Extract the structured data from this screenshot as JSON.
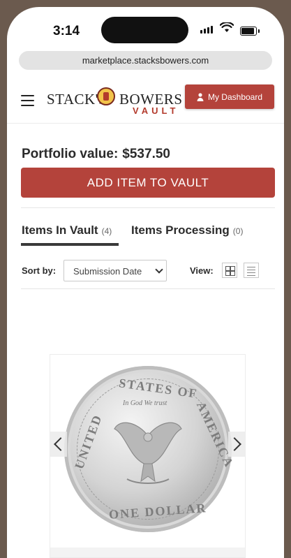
{
  "status_bar": {
    "time": "3:14"
  },
  "browser": {
    "url": "marketplace.stacksbowers.com"
  },
  "header": {
    "logo_word_1": "STACK'S",
    "logo_word_2": "BOWERS",
    "logo_word_3": "VAULT",
    "dashboard_label": "My Dashboard"
  },
  "portfolio": {
    "label": "Portfolio value:",
    "value": "$537.50"
  },
  "add_item_label": "ADD ITEM TO VAULT",
  "tabs": [
    {
      "label": "Items In Vault",
      "count": "(4)"
    },
    {
      "label": "Items Processing",
      "count": "(0)"
    }
  ],
  "sort": {
    "label": "Sort by:",
    "selected": "Submission Date"
  },
  "view": {
    "label": "View:"
  },
  "coin": {
    "top_text": "STATES OF",
    "left_text": "UNITED",
    "right_text": "AMERICA",
    "motto": "In God We trust",
    "bottom_text": "ONE DOLLAR"
  },
  "colors": {
    "accent": "#b4433b",
    "text": "#2b2b2b"
  }
}
